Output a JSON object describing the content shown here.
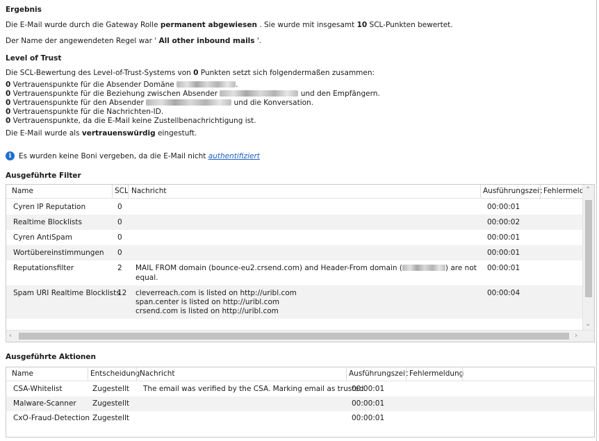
{
  "result": {
    "heading": "Ergebnis",
    "line1_pre": "Die E-Mail wurde durch die Gateway Rolle ",
    "line1_bold": "permanent abgewiesen",
    "line1_mid": " .  Sie wurde mit insgesamt ",
    "line1_count": "10",
    "line1_post": " SCL-Punkten bewertet.",
    "line2_pre": "Der Name der angewendeten Regel war ' ",
    "line2_bold": "All other inbound mails",
    "line2_post": " '."
  },
  "trust": {
    "heading": "Level of Trust",
    "intro_pre": "Die SCL-Bewertung des Level-of-Trust-Systems von ",
    "intro_bold": "0",
    "intro_post": " Punkten setzt sich folgendermaßen zusammen:",
    "items": [
      {
        "points": "0",
        "text": "  Vertrauenspunkte für die Absender Domäne ",
        "after": "."
      },
      {
        "points": "0",
        "text": "  Vertrauenspunkte für die Beziehung zwischen Absender ",
        "after": " und den Empfängern."
      },
      {
        "points": "0",
        "text": "  Vertrauenspunkte für den Absender ",
        "after": " und die Konversation."
      },
      {
        "points": "0",
        "text": "  Vertrauenspunkte für die Nachrichten-ID.",
        "after": ""
      },
      {
        "points": "0",
        "text": "  Vertrauenspunkte, da die E-Mail keine Zustellbenachrichtigung ist.",
        "after": ""
      }
    ],
    "classified_pre": "Die E-Mail wurde als ",
    "classified_bold": "vertrauenswürdig",
    "classified_post": " eingestuft.",
    "info_text": "Es wurden keine Boni vergeben, da die E-Mail nicht ",
    "info_link": "authentifiziert",
    "info_icon": "info-icon"
  },
  "filters": {
    "heading": "Ausgeführte Filter",
    "columns": [
      "Name",
      "SCL",
      "Nachricht",
      "Ausführungszeit",
      "Fehlermeld"
    ],
    "rows": [
      {
        "name": "Cyren IP Reputation",
        "scl": "0",
        "msg1": "",
        "msg2": "",
        "msg3": "",
        "time": "00:00:01"
      },
      {
        "name": "Realtime Blocklists",
        "scl": "0",
        "msg1": "",
        "msg2": "",
        "msg3": "",
        "time": "00:00:02"
      },
      {
        "name": "Cyren AntiSpam",
        "scl": "0",
        "msg1": "",
        "msg2": "",
        "msg3": "",
        "time": "00:00:01"
      },
      {
        "name": "Wortübereinstimmungen",
        "scl": "0",
        "msg1": "",
        "msg2": "",
        "msg3": "",
        "time": "00:00:01"
      },
      {
        "name": "Reputationsfilter",
        "scl": "2",
        "msg1": "MAIL FROM domain (bounce-eu2.crsend.com) and Header-From domain (",
        "msg1_after": ") are not",
        "msg2": "equal.",
        "msg3": "",
        "time": "00:00:01"
      },
      {
        "name": "Spam URI Realtime Blocklists",
        "scl": "12",
        "msg1": "cleverreach.com is listed on http://uribl.com",
        "msg2": "span.center is listed on http://uribl.com",
        "msg3": "crsend.com is listed on http://uribl.com",
        "time": "00:00:04"
      }
    ]
  },
  "actions": {
    "heading": "Ausgeführte Aktionen",
    "columns": [
      "Name",
      "Entscheidung",
      "Nachricht",
      "Ausführungszeit",
      "Fehlermeldung"
    ],
    "rows": [
      {
        "name": "CSA-Whitelist",
        "decision": "Zugestellt",
        "msg": "The email was verified by the CSA. Marking email as trusted.",
        "time": "00:00:01"
      },
      {
        "name": "Malware-Scanner",
        "decision": "Zugestellt",
        "msg": "",
        "time": "00:00:01"
      },
      {
        "name": "CxO-Fraud-Detection",
        "decision": "Zugestellt",
        "msg": "",
        "time": "00:00:01"
      }
    ]
  }
}
